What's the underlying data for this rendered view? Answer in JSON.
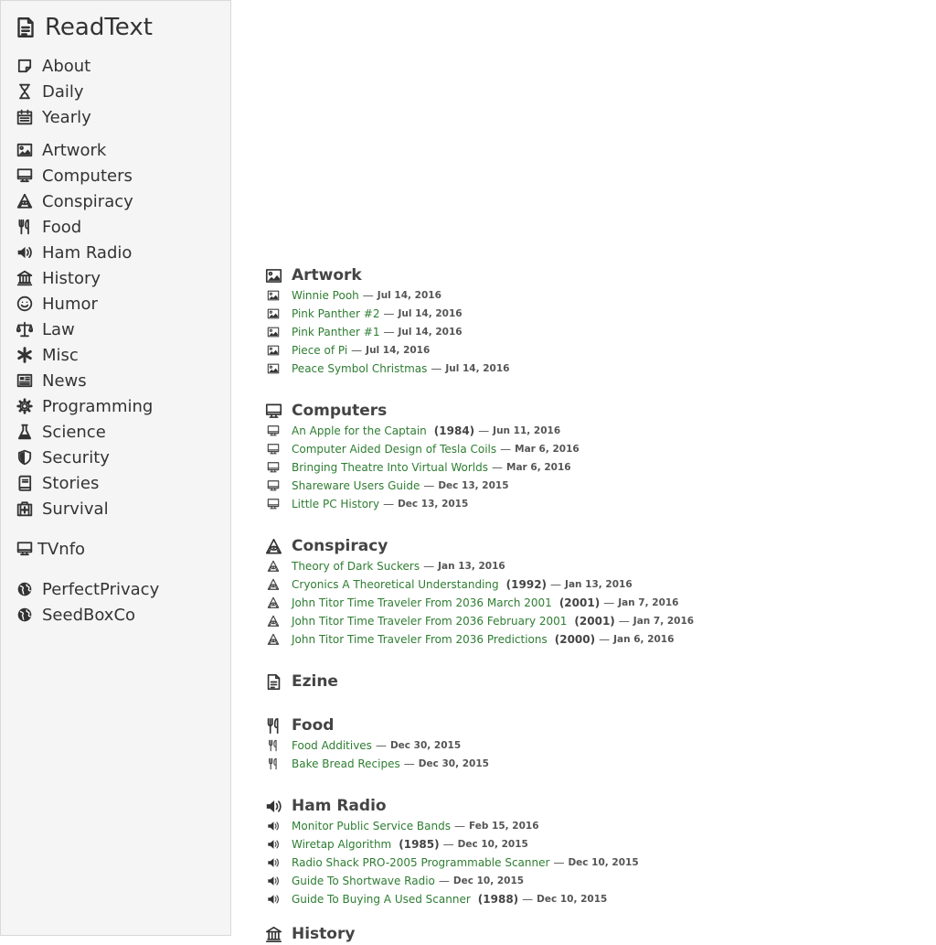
{
  "brand": {
    "title": "ReadText",
    "icon": "document-icon"
  },
  "nav": {
    "about": "About",
    "daily": "Daily",
    "yearly": "Yearly",
    "artwork": "Artwork",
    "computers": "Computers",
    "conspiracy": "Conspiracy",
    "food": "Food",
    "ham_radio": "Ham Radio",
    "history": "History",
    "humor": "Humor",
    "law": "Law",
    "misc": "Misc",
    "news": "News",
    "programming": "Programming",
    "science": "Science",
    "security": "Security",
    "stories": "Stories",
    "survival": "Survival",
    "tvnfo": "TVnfo",
    "perfectprivacy": "PerfectPrivacy",
    "seedboxco": "SeedBoxCo"
  },
  "colors": {
    "link": "#2e7d32",
    "sidebar_bg": "#f5f5f5"
  },
  "sections": {
    "artwork": {
      "title": "Artwork",
      "items": [
        {
          "title": "Winnie Pooh",
          "date": "Jul 14, 2016"
        },
        {
          "title": "Pink Panther #2",
          "date": "Jul 14, 2016"
        },
        {
          "title": "Pink Panther #1",
          "date": "Jul 14, 2016"
        },
        {
          "title": "Piece of Pi",
          "date": "Jul 14, 2016"
        },
        {
          "title": "Peace Symbol Christmas",
          "date": "Jul 14, 2016"
        }
      ]
    },
    "computers": {
      "title": "Computers",
      "items": [
        {
          "title": "An Apple for the Captain",
          "year": "(1984)",
          "date": "Jun 11, 2016"
        },
        {
          "title": "Computer Aided Design of Tesla Coils",
          "date": "Mar 6, 2016"
        },
        {
          "title": "Bringing Theatre Into Virtual Worlds",
          "date": "Mar 6, 2016"
        },
        {
          "title": "Shareware Users Guide",
          "date": "Dec 13, 2015"
        },
        {
          "title": "Little PC History",
          "date": "Dec 13, 2015"
        }
      ]
    },
    "conspiracy": {
      "title": "Conspiracy",
      "items": [
        {
          "title": "Theory of Dark Suckers",
          "date": "Jan 13, 2016"
        },
        {
          "title": "Cryonics A Theoretical Understanding",
          "year": "(1992)",
          "date": "Jan 13, 2016"
        },
        {
          "title": "John Titor Time Traveler From 2036 March 2001",
          "year": "(2001)",
          "date": "Jan 7, 2016"
        },
        {
          "title": "John Titor Time Traveler From 2036 February 2001",
          "year": "(2001)",
          "date": "Jan 7, 2016"
        },
        {
          "title": "John Titor Time Traveler From 2036 Predictions",
          "year": "(2000)",
          "date": "Jan 6, 2016"
        }
      ]
    },
    "ezine": {
      "title": "Ezine"
    },
    "food": {
      "title": "Food",
      "items": [
        {
          "title": "Food Additives",
          "date": "Dec 30, 2015"
        },
        {
          "title": "Bake Bread Recipes",
          "date": "Dec 30, 2015"
        }
      ]
    },
    "ham_radio": {
      "title": "Ham Radio",
      "items": [
        {
          "title": "Monitor Public Service Bands",
          "date": "Feb 15, 2016"
        },
        {
          "title": "Wiretap Algorithm",
          "year": "(1985)",
          "date": "Dec 10, 2015"
        },
        {
          "title": "Radio Shack PRO-2005 Programmable Scanner",
          "date": "Dec 10, 2015"
        },
        {
          "title": "Guide To Shortwave Radio",
          "date": "Dec 10, 2015"
        },
        {
          "title": "Guide To Buying A Used Scanner",
          "year": "(1988)",
          "date": "Dec 10, 2015"
        }
      ]
    },
    "history": {
      "title": "History"
    }
  }
}
